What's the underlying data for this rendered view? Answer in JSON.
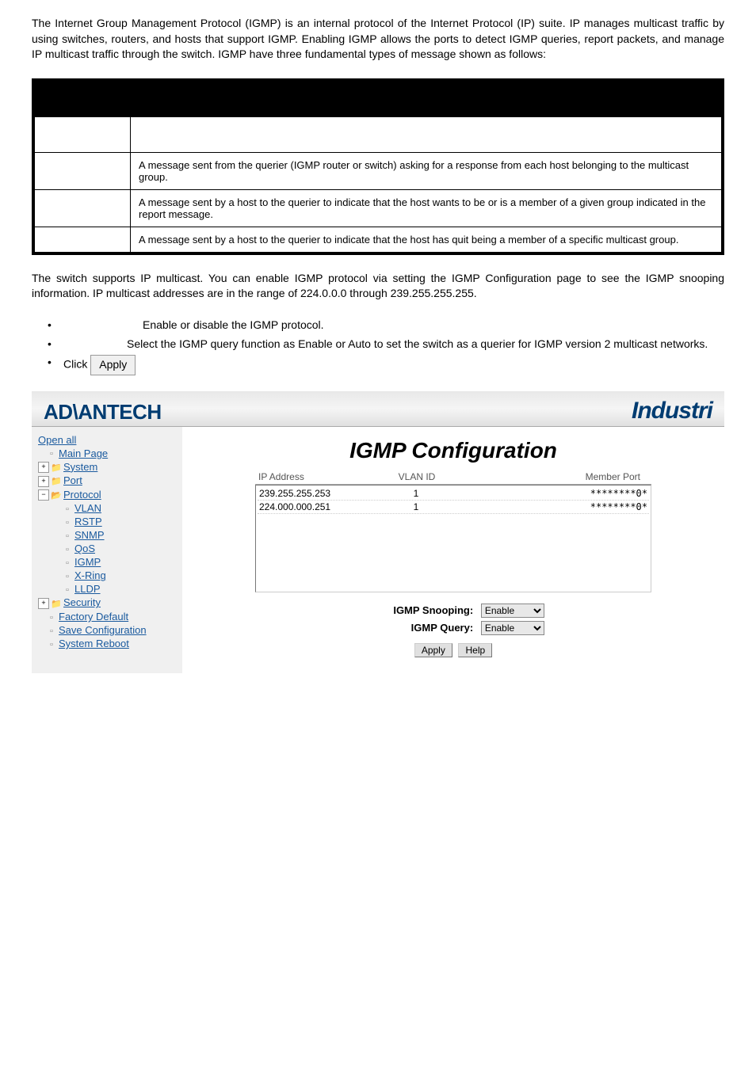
{
  "intro": "The Internet Group Management Protocol (IGMP) is an internal protocol of the Internet Protocol (IP) suite. IP manages multicast traffic by using switches, routers, and hosts that support IGMP. Enabling IGMP allows the ports to detect IGMP queries, report packets, and manage IP multicast traffic through the switch. IGMP have three fundamental types of message shown as follows:",
  "messages": [
    "A message sent from the querier (IGMP router or switch) asking for a response from each host belonging to the multicast group.",
    "A message sent by a host to the querier to indicate that the host wants to be or is a member of a given group indicated in the report message.",
    "A message sent by a host to the querier to indicate that the host has quit being a member of a specific multicast group."
  ],
  "description": "The switch supports IP multicast. You can enable IGMP protocol via setting the IGMP Configuration page to see the IGMP snooping information. IP multicast addresses are in the range of 224.0.0.0 through 239.255.255.255.",
  "bullets": {
    "b1": "Enable or disable the IGMP protocol.",
    "b2": "Select the IGMP query function as Enable or Auto to set the switch as a querier for IGMP version 2 multicast networks.",
    "b3_prefix": "Click",
    "b3_button": "Apply"
  },
  "brand": {
    "left": "AD\\ANTECH",
    "right": "Industri"
  },
  "sidebar": {
    "open_all": "Open all",
    "main_page": "Main Page",
    "system": "System",
    "port": "Port",
    "protocol": "Protocol",
    "vlan": "VLAN",
    "rstp": "RSTP",
    "snmp": "SNMP",
    "qos": "QoS",
    "igmp": "IGMP",
    "xring": "X-Ring",
    "lldp": "LLDP",
    "security": "Security",
    "factory_default": "Factory Default",
    "save_config": "Save Configuration",
    "system_reboot": "System Reboot"
  },
  "panel": {
    "title": "IGMP Configuration",
    "headers": {
      "ip": "IP Address",
      "vlan": "VLAN ID",
      "member": "Member Port"
    },
    "rows": [
      {
        "ip": "239.255.255.253",
        "vlan": "1",
        "member": "********0*"
      },
      {
        "ip": "224.000.000.251",
        "vlan": "1",
        "member": "********0*"
      }
    ],
    "snooping_label": "IGMP Snooping:",
    "query_label": "IGMP Query:",
    "snooping_value": "Enable",
    "query_value": "Enable",
    "apply": "Apply",
    "help": "Help"
  }
}
